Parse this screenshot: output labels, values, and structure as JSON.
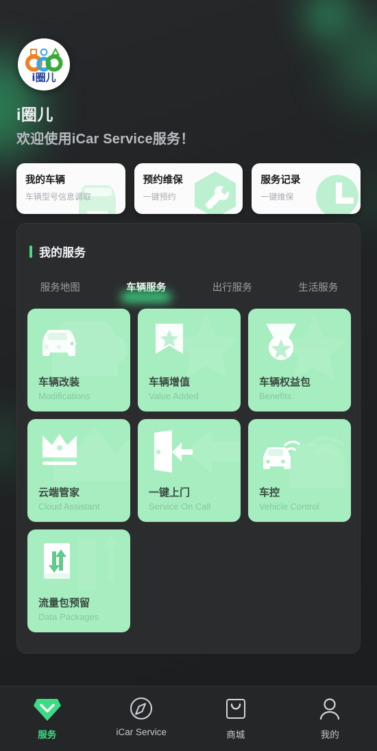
{
  "app": {
    "brand_title": "i圈儿",
    "brand_subtitle": "欢迎使用iCar Service服务！",
    "logo_text": "i圈儿",
    "accent_color": "#3ddc84",
    "tile_color": "#a6edc0",
    "panel_color": "#2b2c2e",
    "background_color": "#202224"
  },
  "quick_cards": [
    {
      "title": "我的车辆",
      "subtitle": "车辆型号信息调取",
      "icon": "car-icon"
    },
    {
      "title": "预约维保",
      "subtitle": "一键预约",
      "icon": "wrench-hexagon-icon"
    },
    {
      "title": "服务记录",
      "subtitle": "一键维保",
      "icon": "clock-icon"
    }
  ],
  "services_panel": {
    "title": "我的服务",
    "tabs": [
      {
        "label": "服务地图",
        "active": false
      },
      {
        "label": "车辆服务",
        "active": true
      },
      {
        "label": "出行服务",
        "active": false
      },
      {
        "label": "生活服务",
        "active": false
      }
    ],
    "tiles": [
      {
        "cn": "车辆改装",
        "en": "Modifications",
        "icon": "car-gear-icon"
      },
      {
        "cn": "车辆增值",
        "en": "Value Added",
        "icon": "badge-star-icon"
      },
      {
        "cn": "车辆权益包",
        "en": "Benefits",
        "icon": "medal-star-icon"
      },
      {
        "cn": "云端管家",
        "en": "Cloud Assistant",
        "icon": "crown-icon"
      },
      {
        "cn": "一键上门",
        "en": "Service On Call",
        "icon": "door-arrow-icon"
      },
      {
        "cn": "车控",
        "en": "Vehicle Control",
        "icon": "car-wifi-icon"
      },
      {
        "cn": "流量包预留",
        "en": "Data Packages",
        "icon": "data-transfer-icon"
      }
    ]
  },
  "bottom_nav": [
    {
      "label": "服务",
      "icon": "shield-check-icon",
      "active": true
    },
    {
      "label": "iCar Service",
      "icon": "compass-icon",
      "active": false
    },
    {
      "label": "商城",
      "icon": "shopping-bag-icon",
      "active": false
    },
    {
      "label": "我的",
      "icon": "person-icon",
      "active": false
    }
  ]
}
